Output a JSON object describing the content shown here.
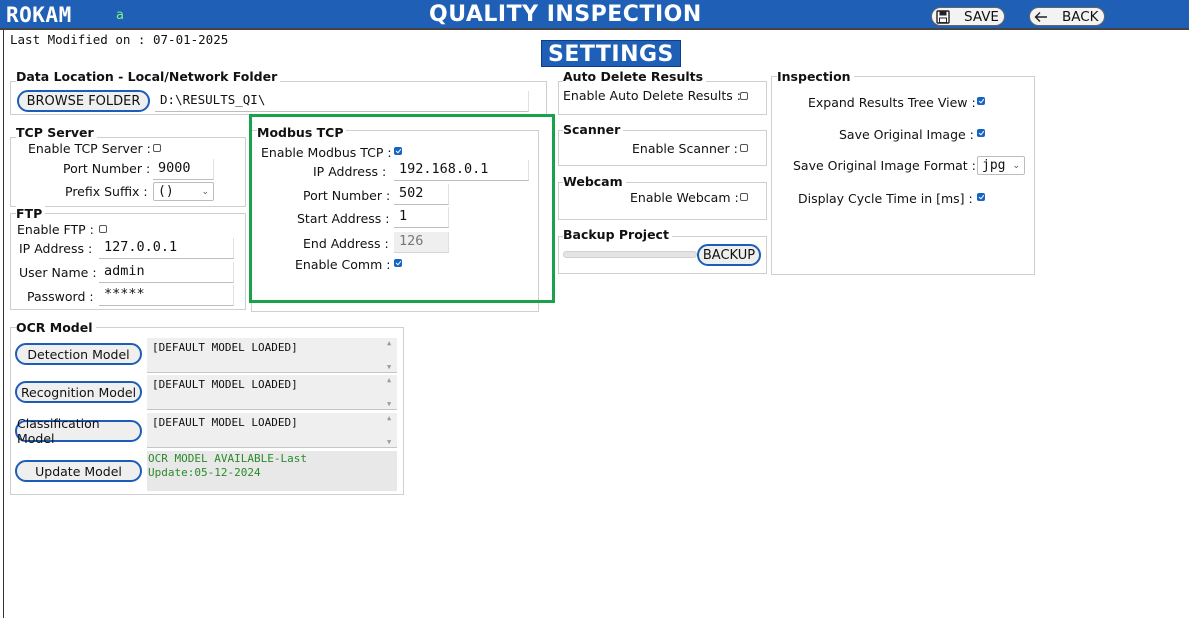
{
  "header": {
    "brand": "ROKAM",
    "brand_suffix": "a",
    "title": "QUALITY INSPECTION",
    "save_label": "SAVE",
    "back_label": "BACK",
    "save_icon": "floppy-disk-icon",
    "back_icon": "arrow-left-icon"
  },
  "last_modified": "Last Modified on : 07-01-2025",
  "page_heading": "SETTINGS",
  "data_location": {
    "legend": "Data Location - Local/Network Folder",
    "browse_label": "BROWSE FOLDER",
    "path_value": "D:\\RESULTS_QI\\"
  },
  "tcp_server": {
    "legend": "TCP Server",
    "enable_label": "Enable TCP Server :",
    "enable_checked": false,
    "port_label": "Port Number :",
    "port_value": "9000",
    "prefix_label": "Prefix Suffix :",
    "prefix_value": "()"
  },
  "ftp": {
    "legend": "FTP",
    "enable_label": "Enable FTP :",
    "enable_checked": false,
    "ip_label": "IP Address :",
    "ip_value": "127.0.0.1",
    "user_label": "User Name :",
    "user_value": "admin",
    "password_label": "Password :",
    "password_value": "*****"
  },
  "modbus": {
    "legend": "Modbus TCP",
    "enable_label": "Enable Modbus TCP :",
    "enable_checked": true,
    "ip_label": "IP Address :",
    "ip_value": "192.168.0.1",
    "port_label": "Port Number :",
    "port_value": "502",
    "start_label": "Start Address :",
    "start_value": "1",
    "end_label": "End Address :",
    "end_value": "126",
    "comm_label": "Enable Comm :",
    "comm_checked": true
  },
  "auto_delete": {
    "legend": "Auto Delete Results",
    "enable_label": "Enable Auto Delete Results :",
    "enable_checked": false
  },
  "scanner": {
    "legend": "Scanner",
    "enable_label": "Enable Scanner :",
    "enable_checked": false
  },
  "webcam": {
    "legend": "Webcam",
    "enable_label": "Enable Webcam :",
    "enable_checked": false
  },
  "backup": {
    "legend": "Backup Project",
    "button_label": "BACKUP",
    "progress": 0.0
  },
  "inspection": {
    "legend": "Inspection",
    "expand_label": "Expand Results Tree View :",
    "expand_checked": true,
    "save_original_label": "Save Original Image :",
    "save_original_checked": true,
    "format_label": "Save Original Image Format :",
    "format_value": "jpg",
    "cycle_label": "Display Cycle Time in [ms] :",
    "cycle_checked": true
  },
  "ocr_model": {
    "legend": "OCR Model",
    "detection_label": "Detection Model",
    "detection_status": "[DEFAULT MODEL LOADED]",
    "recognition_label": "Recognition Model",
    "recognition_status": "[DEFAULT MODEL LOADED]",
    "classification_label": "Classification Model",
    "classification_status": "[DEFAULT MODEL LOADED]",
    "update_label": "Update Model",
    "update_status_line1": "OCR MODEL AVAILABLE-Last",
    "update_status_line2": "Update:05-12-2024"
  },
  "colors": {
    "header_bg": "#1f5fb6",
    "accent": "#1565c0",
    "highlight": "#1aa24a",
    "status_text": "#2a8a2a"
  }
}
